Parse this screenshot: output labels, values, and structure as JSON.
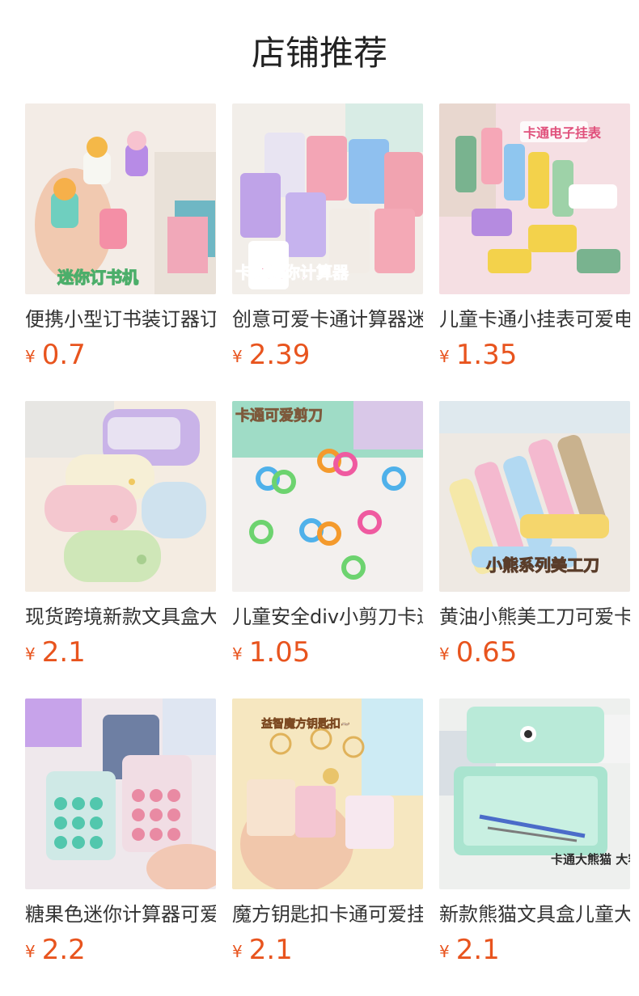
{
  "section_title": "店铺推荐",
  "currency_symbol": "¥",
  "colors": {
    "price": "#e8541e",
    "text": "#333333"
  },
  "products": [
    {
      "name": "便携小型订书装订器订书机",
      "price": "0.7",
      "image_caption": "迷你订书机"
    },
    {
      "name": "创意可爱卡通计算器迷你",
      "price": "2.39",
      "image_caption": "卡通迷你计算器"
    },
    {
      "name": "儿童卡通小挂表可爱电子表",
      "price": "1.35",
      "image_caption": "卡通电子挂表"
    },
    {
      "name": "现货跨境新款文具盒大容量",
      "price": "2.1",
      "image_caption": ""
    },
    {
      "name": "儿童安全div小剪刀卡通",
      "price": "1.05",
      "image_caption": "卡通可爱剪刀"
    },
    {
      "name": "黄油小熊美工刀可爱卡通",
      "price": "0.65",
      "image_caption": "小熊系列美工刀"
    },
    {
      "name": "糖果色迷你计算器可爱便携",
      "price": "2.2",
      "image_caption": ""
    },
    {
      "name": "魔方钥匙扣卡通可爱挂件",
      "price": "2.1",
      "image_caption": "益智魔方钥匙扣~"
    },
    {
      "name": "新款熊猫文具盒儿童大容量",
      "price": "2.1",
      "image_caption": "卡通大熊猫 大容量笔盒"
    }
  ]
}
